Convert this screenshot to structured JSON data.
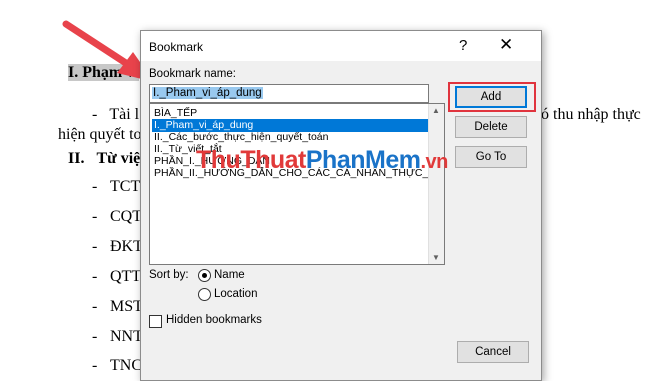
{
  "document": {
    "heading1": "I. Phạm vi",
    "para_text": "Tài l",
    "para_right": "ó thu nhập thực",
    "para_line2": "hiện quyết to",
    "heading2_num": "II.",
    "heading2_text": "Từ việ",
    "bullets": [
      "TCT",
      "CQT",
      "ĐKT",
      "QTT",
      "MST",
      "NNT",
      "TNC"
    ],
    "bullet_char": "-"
  },
  "dialog": {
    "title": "Bookmark",
    "help_label": "?",
    "close_label": "✕",
    "name_label": "Bookmark name:",
    "name_value": "I._Pham_vi_áp_dung",
    "list_items": [
      "BÌA_TẾP",
      "I._Pham_vi_áp_dung",
      "II._Các_bước_thực_hiện_quyết_toán",
      "II._Từ_viết_tắt",
      "PHẦN_I._HƯỚNG_DẪN",
      "PHẦN_II._HƯỚNG_DẪN_CHO_CÁC_CÁ_NHÂN_THỰC_"
    ],
    "selected_index": 1,
    "buttons": {
      "add": "Add",
      "delete": "Delete",
      "goto": "Go To",
      "cancel": "Cancel"
    },
    "sort_by_label": "Sort by:",
    "sort_name_label": "Name",
    "sort_location_label": "Location",
    "sort_selected": "Name",
    "hidden_label": "Hidden bookmarks",
    "hidden_checked": false
  },
  "watermark": {
    "part1": "Thu",
    "part2": "Thuat",
    "part3": "Phan",
    "part4": "Mem",
    "part5": ".vn"
  },
  "colors": {
    "highlight_box": "#e0343e",
    "arrow": "#e8434b",
    "selection": "#0078d7"
  }
}
